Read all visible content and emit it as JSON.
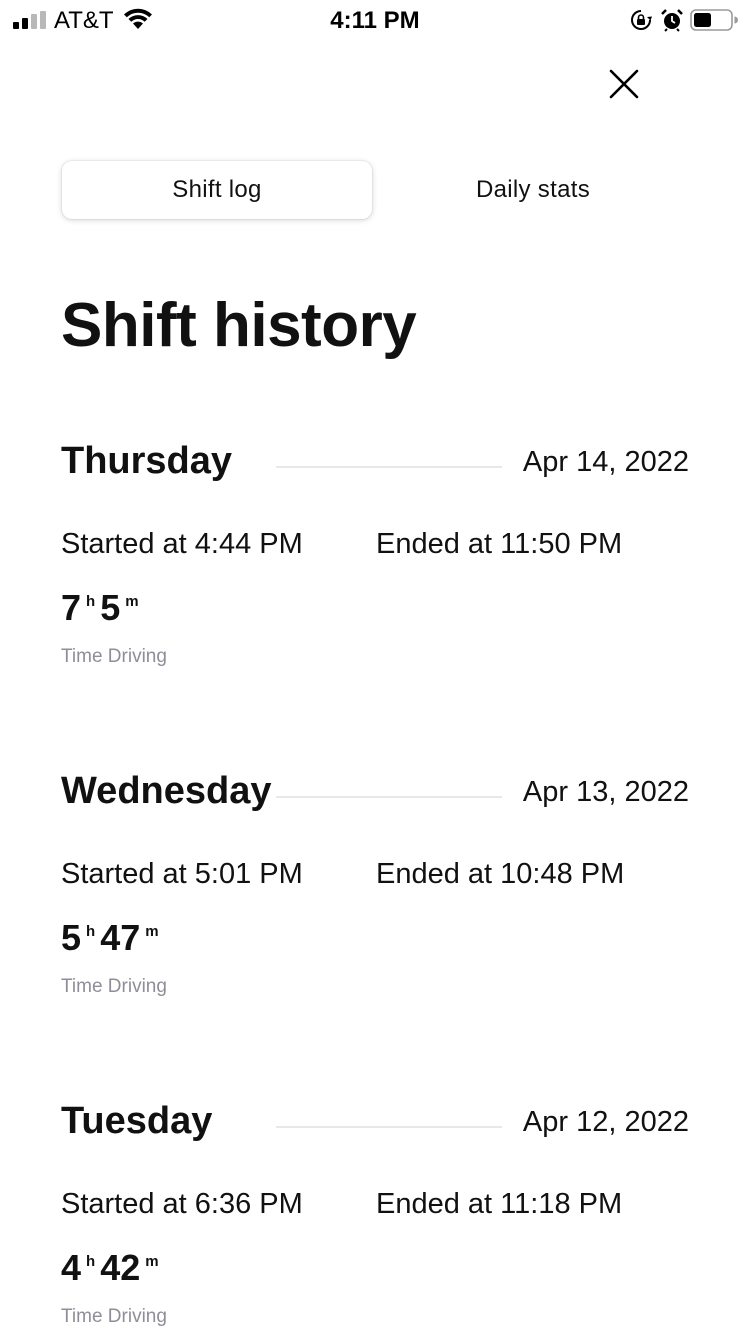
{
  "status_bar": {
    "carrier": "AT&T",
    "time": "4:11 PM"
  },
  "tabs": [
    {
      "label": "Shift log",
      "selected": true
    },
    {
      "label": "Daily stats",
      "selected": false
    }
  ],
  "page_title": "Shift history",
  "shifts": [
    {
      "day": "Thursday",
      "date": "Apr 14, 2022",
      "started": "Started at 4:44 PM",
      "ended": "Ended at 11:50 PM",
      "hours": "7",
      "hours_unit": "h",
      "minutes": "5",
      "minutes_unit": "m",
      "label": "Time Driving"
    },
    {
      "day": "Wednesday",
      "date": "Apr 13, 2022",
      "started": "Started at 5:01 PM",
      "ended": "Ended at 10:48 PM",
      "hours": "5",
      "hours_unit": "h",
      "minutes": "47",
      "minutes_unit": "m",
      "label": "Time Driving"
    },
    {
      "day": "Tuesday",
      "date": "Apr 12, 2022",
      "started": "Started at 6:36 PM",
      "ended": "Ended at 11:18 PM",
      "hours": "4",
      "hours_unit": "h",
      "minutes": "42",
      "minutes_unit": "m",
      "label": "Time Driving"
    }
  ],
  "icons": {
    "signal": "cellular-signal-icon",
    "wifi": "wifi-icon",
    "rotation_lock": "rotation-lock-icon",
    "alarm": "alarm-clock-icon",
    "battery": "battery-icon",
    "close": "close-icon"
  },
  "colors": {
    "text": "#111111",
    "muted_label": "#8e8e99",
    "divider": "#e8e8ea",
    "background": "#ffffff"
  }
}
